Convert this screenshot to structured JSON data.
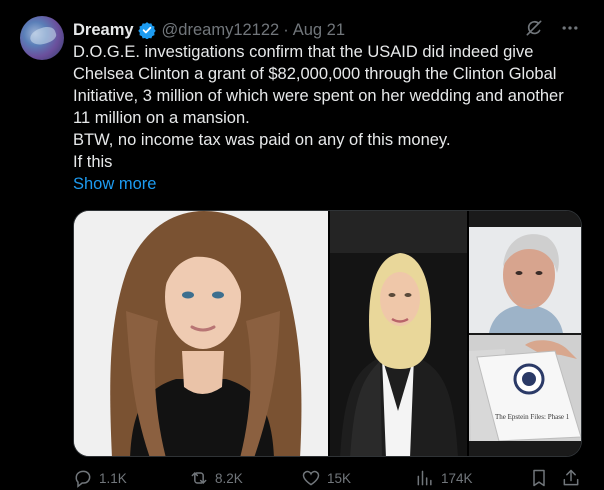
{
  "post": {
    "author_name": "Dreamy",
    "handle": "@dreamy12122",
    "separator": "·",
    "date": "Aug 21",
    "text_lines": [
      "D.O.G.E. investigations confirm that the USAID did indeed give Chelsea Clinton a grant of $82,000,000 through the Clinton Global Initiative, 3 million of which were spent on her wedding and another 11 million on a mansion.",
      "BTW, no income tax was paid on any of this money.",
      "If this"
    ],
    "show_more": "Show more"
  },
  "media": {
    "document_title": "The Epstein Files: Phase 1"
  },
  "actions": {
    "replies": "1.1K",
    "reposts": "8.2K",
    "likes": "15K",
    "views": "174K"
  },
  "colors": {
    "background": "#000000",
    "text": "#e7e9ea",
    "muted": "#71767b",
    "link": "#1d9bf0",
    "verified": "#1d9bf0"
  },
  "icons": [
    "verified-badge-icon",
    "grok-icon",
    "more-icon",
    "reply-icon",
    "repost-icon",
    "like-icon",
    "views-icon",
    "bookmark-icon",
    "share-icon"
  ]
}
